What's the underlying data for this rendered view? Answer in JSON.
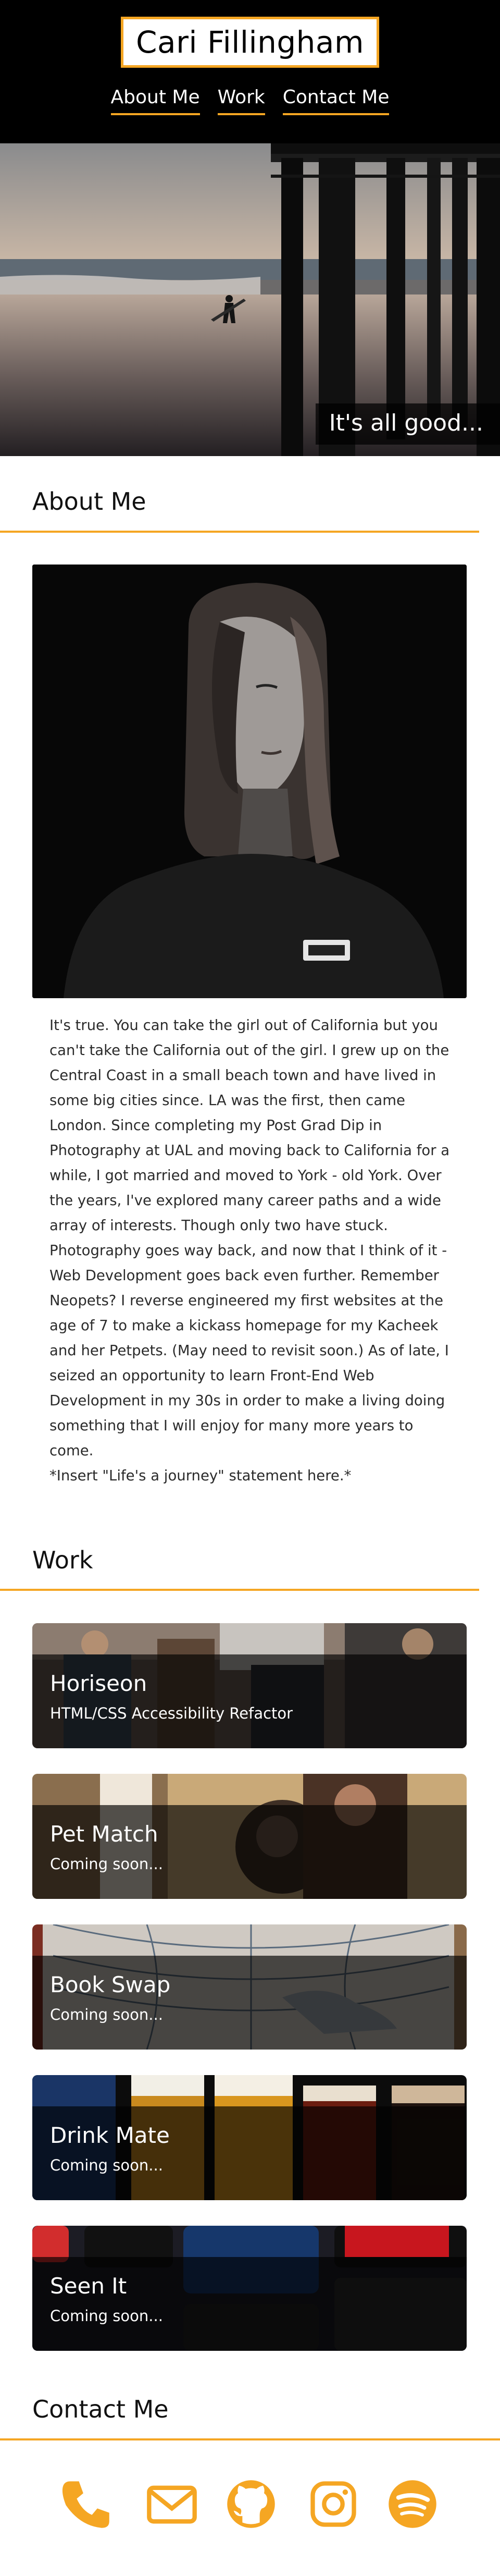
{
  "header": {
    "name": "Cari Fillingham",
    "nav": [
      "About Me",
      "Work",
      "Contact Me"
    ]
  },
  "hero": {
    "caption": "It's all good..."
  },
  "about": {
    "heading": "About Me",
    "paragraphs": [
      "It's true. You can take the girl out of California but you can't take the California out of the girl. I grew up on the Central Coast in a small beach town and have lived in some big cities since. LA was the first, then came London. Since completing my Post Grad Dip in Photography at UAL and moving back to California for a while, I got married and moved to York - old York. Over the years, I've explored many career paths and a wide array of interests. Though only two have stuck. Photography goes way back, and now that I think of it - Web Development goes back even further. Remember Neopets? I reverse engineered my first websites at the age of 7 to make a kickass homepage for my Kacheek and her Petpets. (May need to revisit soon.) As of late, I seized an opportunity to learn Front-End Web Development in my 30s in order to make a living doing something that I will enjoy for many more years to come.",
      "*Insert \"Life's a journey\" statement here.*"
    ]
  },
  "work": {
    "heading": "Work",
    "projects": [
      {
        "title": "Horiseon",
        "subtitle": "HTML/CSS Accessibility Refactor"
      },
      {
        "title": "Pet Match",
        "subtitle": "Coming soon..."
      },
      {
        "title": "Book Swap",
        "subtitle": "Coming soon..."
      },
      {
        "title": "Drink Mate",
        "subtitle": "Coming soon..."
      },
      {
        "title": "Seen It",
        "subtitle": "Coming soon..."
      }
    ]
  },
  "contact": {
    "heading": "Contact Me",
    "icons": [
      "phone-icon",
      "email-icon",
      "github-icon",
      "instagram-icon",
      "spotify-icon"
    ]
  },
  "colors": {
    "accent": "#f5a623",
    "header_bg": "#000000"
  }
}
